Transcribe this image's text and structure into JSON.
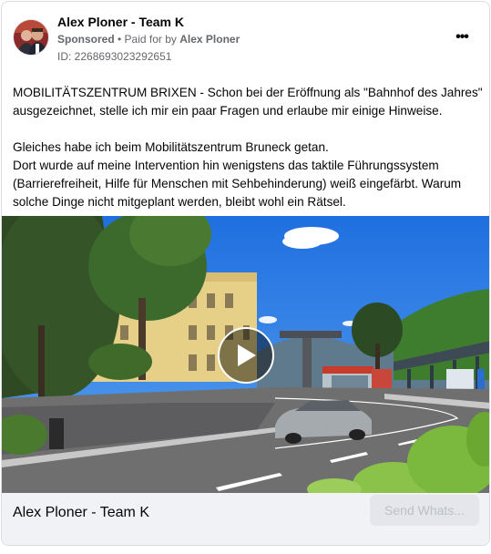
{
  "post": {
    "page_name": "Alex Ploner - Team K",
    "sponsored_label": "Sponsored",
    "separator": " • ",
    "paid_for_prefix": "Paid for by ",
    "paid_for_name": "Alex Ploner",
    "ad_id": "ID: 2268693023292651",
    "more_icon": "more-horizontal-icon",
    "more_glyph": "•••",
    "paragraphs": [
      "MOBILITÄTSZENTRUM BRIXEN - Schon bei der Eröffnung als \"Bahnhof des Jahres\" ausgezeichnet, stelle ich mir ein paar Fragen und erlaube mir einige Hinweise.",
      "Gleiches habe ich beim Mobilitätszentrum Bruneck getan.\nDort wurde auf meine Intervention hin wenigstens das taktile Führungssystem (Barrierefreiheit, Hilfe für Menschen mit Sehbehinderung) weiß eingefärbt. Warum solche Dinge nicht mitgeplant werden, bleibt wohl ein Rätsel."
    ]
  },
  "media": {
    "type": "video",
    "play_icon": "play-icon"
  },
  "footer": {
    "name": "Alex Ploner - Team K",
    "cta_label": "Send Whats..."
  },
  "colors": {
    "secondary_text": "#65676b",
    "footer_bg": "#f0f2f5",
    "button_bg": "#e4e6eb",
    "button_text": "#bcc0c4"
  }
}
